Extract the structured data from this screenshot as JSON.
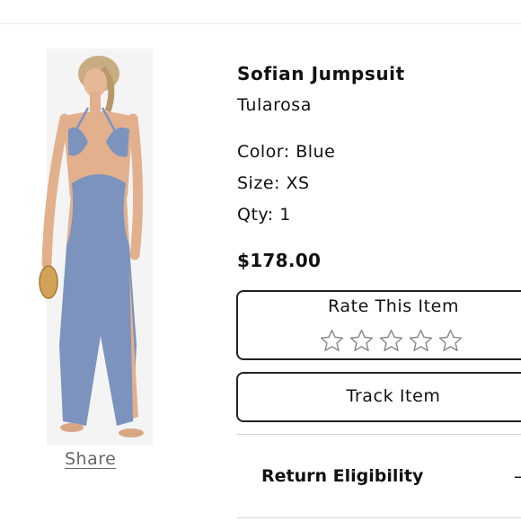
{
  "product": {
    "title": "Sofian Jumpsuit",
    "brand": "Tularosa",
    "color_line": "Color: Blue",
    "size_line": "Size: XS",
    "qty_line": "Qty: 1",
    "price": "$178.00",
    "image_icon": "product-photo",
    "jumpsuit_color": "#7c93be"
  },
  "share": {
    "label": "Share"
  },
  "rating": {
    "title": "Rate This Item",
    "max_stars": 5,
    "current": 0,
    "star_icon": "star-outline"
  },
  "track": {
    "label": "Track Item"
  },
  "return": {
    "label": "Return Eligibility",
    "toggle_icon": "minus",
    "toggle_glyph": "–"
  }
}
